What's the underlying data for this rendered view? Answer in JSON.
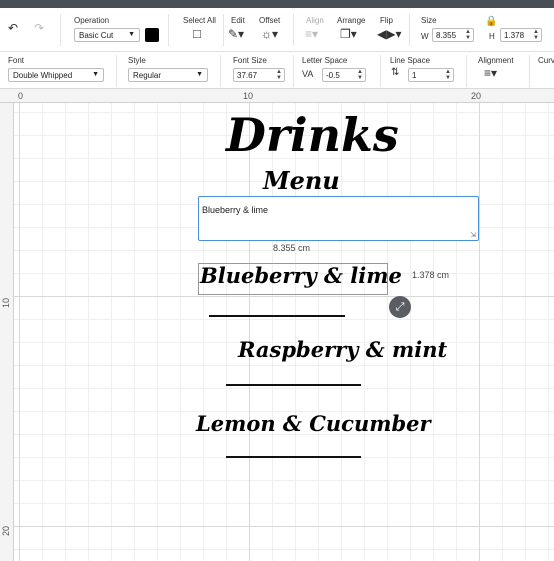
{
  "toolbar": {
    "operation": {
      "label": "Operation",
      "value": "Basic Cut",
      "color": "#000000"
    },
    "select_all": {
      "label": "Select All"
    },
    "edit": {
      "label": "Edit"
    },
    "offset": {
      "label": "Offset"
    },
    "align": {
      "label": "Align"
    },
    "arrange": {
      "label": "Arrange"
    },
    "flip": {
      "label": "Flip"
    },
    "size": {
      "label": "Size",
      "w_label": "W",
      "w_value": "8.355",
      "h_label": "H",
      "h_value": "1.378"
    }
  },
  "text_toolbar": {
    "font": {
      "label": "Font",
      "value": "Double Whipped"
    },
    "style": {
      "label": "Style",
      "value": "Regular"
    },
    "font_size": {
      "label": "Font Size",
      "value": "37.67"
    },
    "letter_space": {
      "label": "Letter Space",
      "value": "-0.5"
    },
    "line_space": {
      "label": "Line Space",
      "value": "1"
    },
    "alignment": {
      "label": "Alignment"
    },
    "curve": {
      "label": "Curve"
    }
  },
  "ruler": {
    "top_ticks": [
      "0",
      "10",
      "20"
    ],
    "left_ticks": [
      "10",
      "20"
    ]
  },
  "canvas": {
    "title": "Drinks",
    "subtitle": "Menu",
    "text_edit_value": "Blueberry & lime",
    "width_label": "8.355 cm",
    "height_label": "1.378 cm",
    "items": [
      "Blueberry & lime",
      "Raspberry & mint",
      "Lemon & Cucumber"
    ]
  }
}
